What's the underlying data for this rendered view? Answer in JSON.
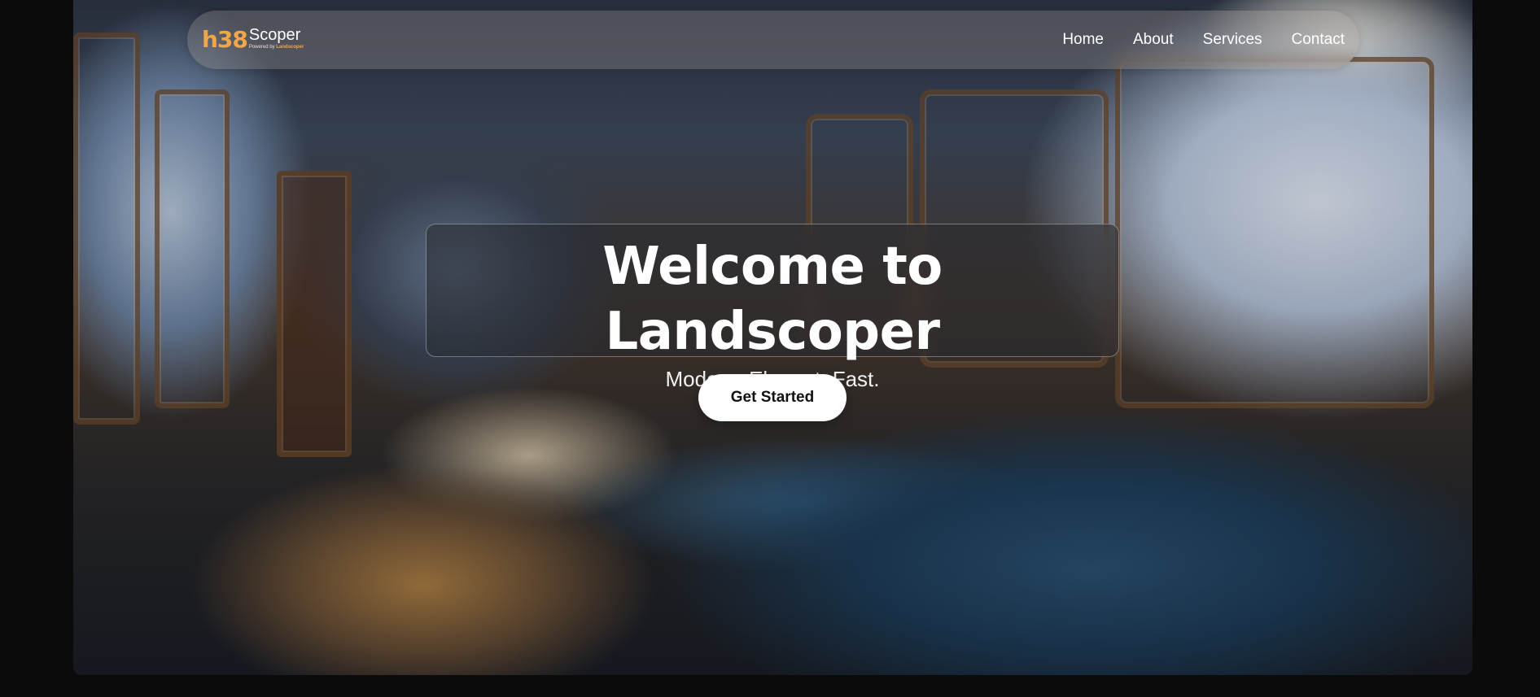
{
  "navbar": {
    "logo": {
      "mark": "h38",
      "name": "Scoper",
      "tagline_prefix": "Powered by",
      "tagline_brand": "Landscoper"
    },
    "links": [
      {
        "label": "Home"
      },
      {
        "label": "About"
      },
      {
        "label": "Services"
      },
      {
        "label": "Contact"
      }
    ]
  },
  "hero": {
    "title": "Welcome to Landscoper",
    "subtitle": "Modern. Elegant. Fast.",
    "cta_label": "Get Started",
    "background_image": "painted-train-interior-snowy-mountains"
  },
  "colors": {
    "page_background": "#0b0b0c",
    "accent_logo": "#f0a64a",
    "text_primary": "#ffffff",
    "cta_background": "#ffffff",
    "cta_text": "#111111"
  }
}
